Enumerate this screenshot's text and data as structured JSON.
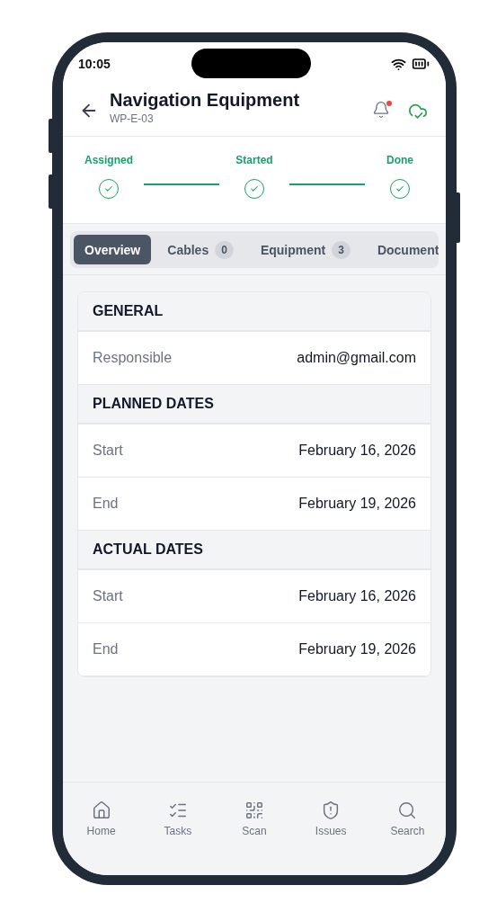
{
  "status_bar": {
    "time": "10:05"
  },
  "header": {
    "title": "Navigation Equipment",
    "subtitle": "WP-E-03",
    "has_notification": true
  },
  "steps": [
    {
      "label": "Assigned",
      "done": true
    },
    {
      "label": "Started",
      "done": true
    },
    {
      "label": "Done",
      "done": true
    }
  ],
  "tabs": [
    {
      "label": "Overview",
      "selected": true
    },
    {
      "label": "Cables",
      "count": "0",
      "selected": false
    },
    {
      "label": "Equipment",
      "count": "3",
      "selected": false
    },
    {
      "label": "Document",
      "selected": false
    }
  ],
  "sections": [
    {
      "title": "GENERAL",
      "rows": [
        {
          "label": "Responsible",
          "value": "admin@gmail.com"
        }
      ]
    },
    {
      "title": "PLANNED DATES",
      "rows": [
        {
          "label": "Start",
          "value": "February 16, 2026"
        },
        {
          "label": "End",
          "value": "February 19, 2026"
        }
      ]
    },
    {
      "title": "ACTUAL DATES",
      "rows": [
        {
          "label": "Start",
          "value": "February 16, 2026"
        },
        {
          "label": "End",
          "value": "February 19, 2026"
        }
      ]
    }
  ],
  "bottom_nav": [
    {
      "label": "Home"
    },
    {
      "label": "Tasks"
    },
    {
      "label": "Scan"
    },
    {
      "label": "Issues"
    },
    {
      "label": "Search"
    }
  ]
}
